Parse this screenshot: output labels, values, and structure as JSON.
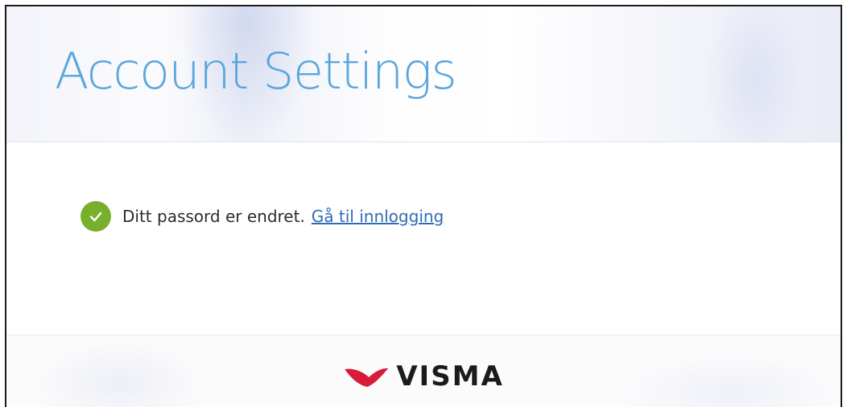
{
  "header": {
    "title": "Account Settings"
  },
  "status": {
    "message": "Ditt passord er endret.",
    "link_label": "Gå til innlogging"
  },
  "footer": {
    "logo_text": "VISMA"
  },
  "colors": {
    "title": "#5aa6df",
    "success": "#78b02e",
    "link": "#2f6bb5",
    "brand_red": "#d71c3a"
  },
  "icons": {
    "status": "check-icon",
    "logo": "visma-logo-mark"
  }
}
